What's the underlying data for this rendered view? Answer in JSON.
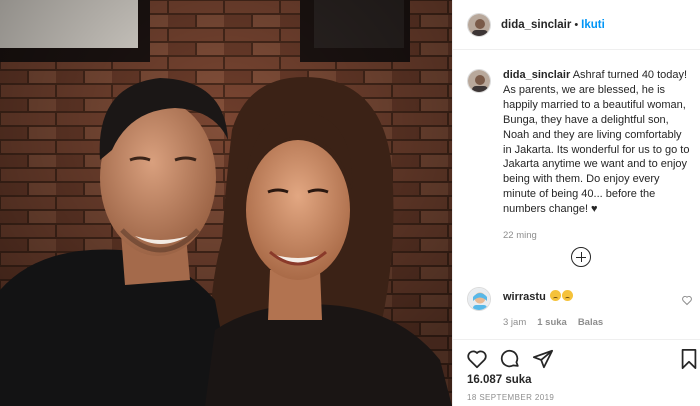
{
  "header": {
    "username": "dida_sinclair",
    "separator": "•",
    "follow_label": "Ikuti"
  },
  "caption": {
    "username": "dida_sinclair",
    "text": "Ashraf turned 40 today! As parents, we are blessed, he is happily married to a beautiful woman, Bunga, they have a delightful son, Noah and they are living comfortably in Jakarta. Its wonderful for us to go to Jakarta anytime we want and to enjoy being with them. Do enjoy every minute of being 40... before the numbers change! ♥",
    "time": "22 ming"
  },
  "comment": {
    "username": "wirrastu",
    "time": "3 jam",
    "likes": "1 suka",
    "reply_label": "Balas"
  },
  "post": {
    "likes": "16.087 suka",
    "date": "18 SEPTEMBER 2019"
  },
  "icons": {
    "like": "heart-icon",
    "comment": "comment-icon",
    "share": "paper-plane-icon",
    "save": "bookmark-icon",
    "load_more": "plus-circle-icon"
  }
}
